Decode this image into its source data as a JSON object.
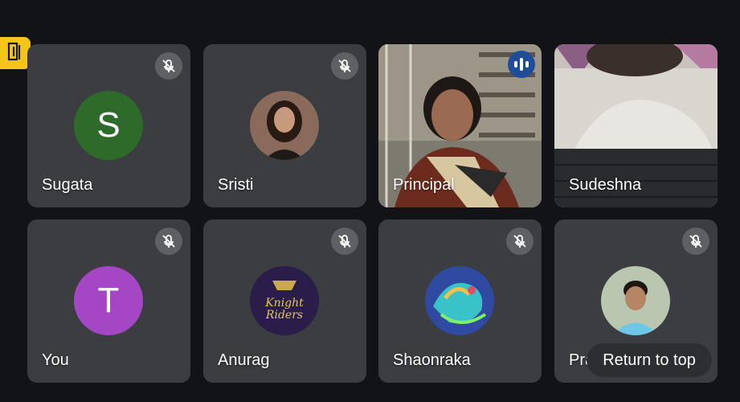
{
  "colors": {
    "background": "#121317",
    "tile": "#3c3d41",
    "active_border": "#2f5aa8",
    "exit_badge": "#f5c518"
  },
  "icons": {
    "exit": "exit-door-icon",
    "mute": "mic-off-icon",
    "speaking": "audio-level-icon"
  },
  "participants": [
    {
      "name": "Sugata",
      "avatar_letter": "S",
      "avatar_color": "#2e6b2a",
      "muted": true
    },
    {
      "name": "Sristi",
      "avatar_type": "photo",
      "muted": true
    },
    {
      "name": "Principal",
      "avatar_type": "video",
      "speaking": true
    },
    {
      "name": "Sudeshna",
      "avatar_type": "video"
    },
    {
      "name": "You",
      "avatar_letter": "T",
      "avatar_color": "#a546c4",
      "muted": true
    },
    {
      "name": "Anurag",
      "avatar_type": "logo",
      "logo_text_1": "Knight",
      "logo_text_2": "Riders",
      "muted": true
    },
    {
      "name": "Shaonraka",
      "avatar_type": "illustration",
      "muted": true
    },
    {
      "name": "Praty",
      "avatar_type": "photo",
      "muted": true
    }
  ],
  "return_to_top": "Return to top"
}
